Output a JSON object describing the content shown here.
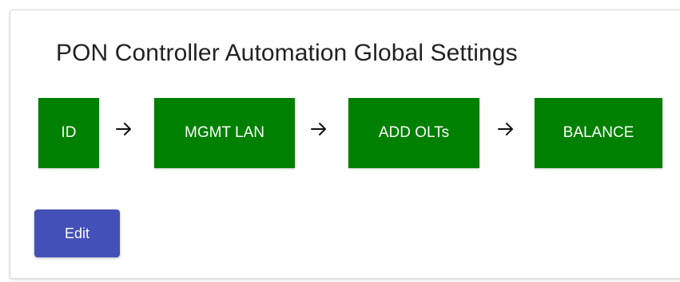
{
  "card": {
    "title": "PON Controller Automation Global Settings"
  },
  "steps": [
    {
      "label": "ID"
    },
    {
      "label": "MGMT LAN"
    },
    {
      "label": "ADD OLTs"
    },
    {
      "label": "BALANCE"
    }
  ],
  "arrows": [
    {
      "icon": "arrow-right-icon"
    },
    {
      "icon": "arrow-right-icon"
    },
    {
      "icon": "arrow-right-icon"
    }
  ],
  "actions": {
    "edit_label": "Edit"
  },
  "colors": {
    "step_complete": "#008000",
    "primary_button": "#4350b8"
  }
}
